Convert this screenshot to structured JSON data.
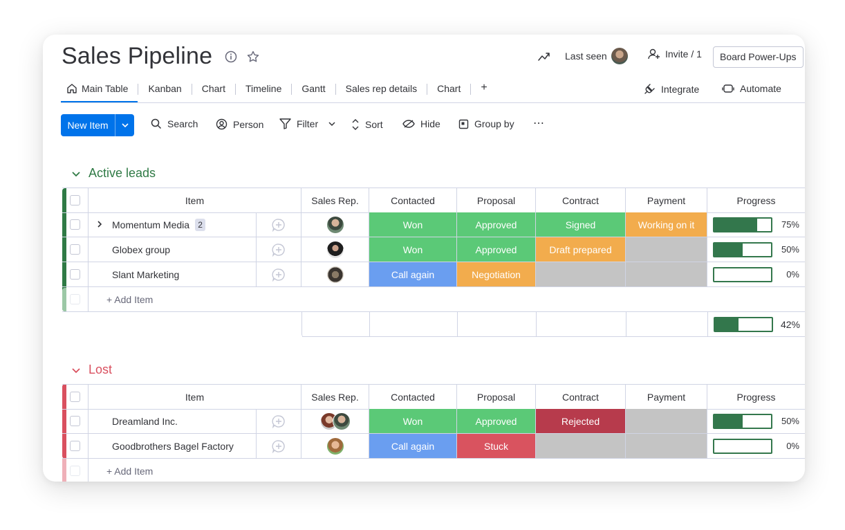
{
  "header": {
    "title": "Sales Pipeline",
    "last_seen_label": "Last seen",
    "invite_label": "Invite / 1",
    "power_ups_label": "Board Power-Ups"
  },
  "tabs": [
    {
      "label": "Main Table",
      "icon": "home-icon",
      "active": true
    },
    {
      "label": "Kanban"
    },
    {
      "label": "Chart"
    },
    {
      "label": "Timeline"
    },
    {
      "label": "Gantt"
    },
    {
      "label": "Sales rep details"
    },
    {
      "label": "Chart"
    }
  ],
  "tabs_add": "+",
  "integrate_label": "Integrate",
  "automate_label": "Automate",
  "toolbar": {
    "new_item": "New Item",
    "search": "Search",
    "person": "Person",
    "filter": "Filter",
    "sort": "Sort",
    "hide": "Hide",
    "group_by": "Group by"
  },
  "columns": [
    "Item",
    "Sales Rep.",
    "Contacted",
    "Proposal",
    "Contract",
    "Payment",
    "Progress"
  ],
  "colors": {
    "green": "#5bc977",
    "blue": "#6a9ef0",
    "orange": "#f2ac4d",
    "red": "#d9535f",
    "darkred": "#b73b4c",
    "grey": "#c4c4c4",
    "active_group": "#2f7a45",
    "lost_group": "#d9505f",
    "progress": "#33774c",
    "accent": "#0073ea"
  },
  "groups": [
    {
      "name": "Active leads",
      "color": "#2f7a45",
      "add_item": "+ Add Item",
      "rows": [
        {
          "name": "Momentum Media",
          "subitems": "2",
          "contacted": "Won",
          "proposal": "Approved",
          "contract": "Signed",
          "payment": "Working on it",
          "progress": "75%",
          "progress_value": 0.75
        },
        {
          "name": "Globex group",
          "contacted": "Won",
          "proposal": "Approved",
          "contract": "Draft prepared",
          "payment": "",
          "progress": "50%",
          "progress_value": 0.5
        },
        {
          "name": "Slant Marketing",
          "contacted": "Call again",
          "proposal": "Negotiation",
          "contract": "",
          "payment": "",
          "progress": "0%",
          "progress_value": 0
        }
      ],
      "summary_progress": "42%",
      "summary_value": 0.42
    },
    {
      "name": "Lost",
      "color": "#d9505f",
      "add_item": "+ Add Item",
      "rows": [
        {
          "name": "Dreamland Inc.",
          "contacted": "Won",
          "proposal": "Approved",
          "contract": "Rejected",
          "payment": "",
          "progress": "50%",
          "progress_value": 0.5
        },
        {
          "name": "Goodbrothers Bagel Factory",
          "contacted": "Call again",
          "proposal": "Stuck",
          "contract": "",
          "payment": "",
          "progress": "0%",
          "progress_value": 0
        }
      ]
    }
  ]
}
